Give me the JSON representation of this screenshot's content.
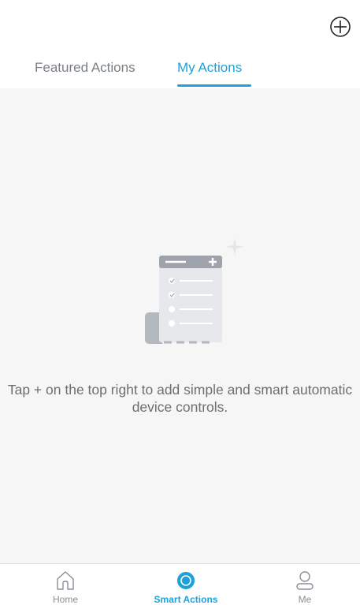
{
  "header": {
    "add_icon": "plus-circle-icon"
  },
  "tabs": [
    {
      "label": "Featured Actions",
      "active": false
    },
    {
      "label": "My Actions",
      "active": true
    }
  ],
  "empty_state": {
    "illustration": "action-list-document-icon",
    "message": "Tap + on the top right to add simple and smart automatic device controls."
  },
  "bottom_nav": [
    {
      "label": "Home",
      "icon": "home-icon",
      "active": false
    },
    {
      "label": "Smart Actions",
      "icon": "smart-actions-icon",
      "active": true
    },
    {
      "label": "Me",
      "icon": "person-icon",
      "active": false
    }
  ],
  "colors": {
    "accent": "#1da1d8",
    "inactive_text": "#7a7f85",
    "content_background": "#f6f6f6"
  }
}
